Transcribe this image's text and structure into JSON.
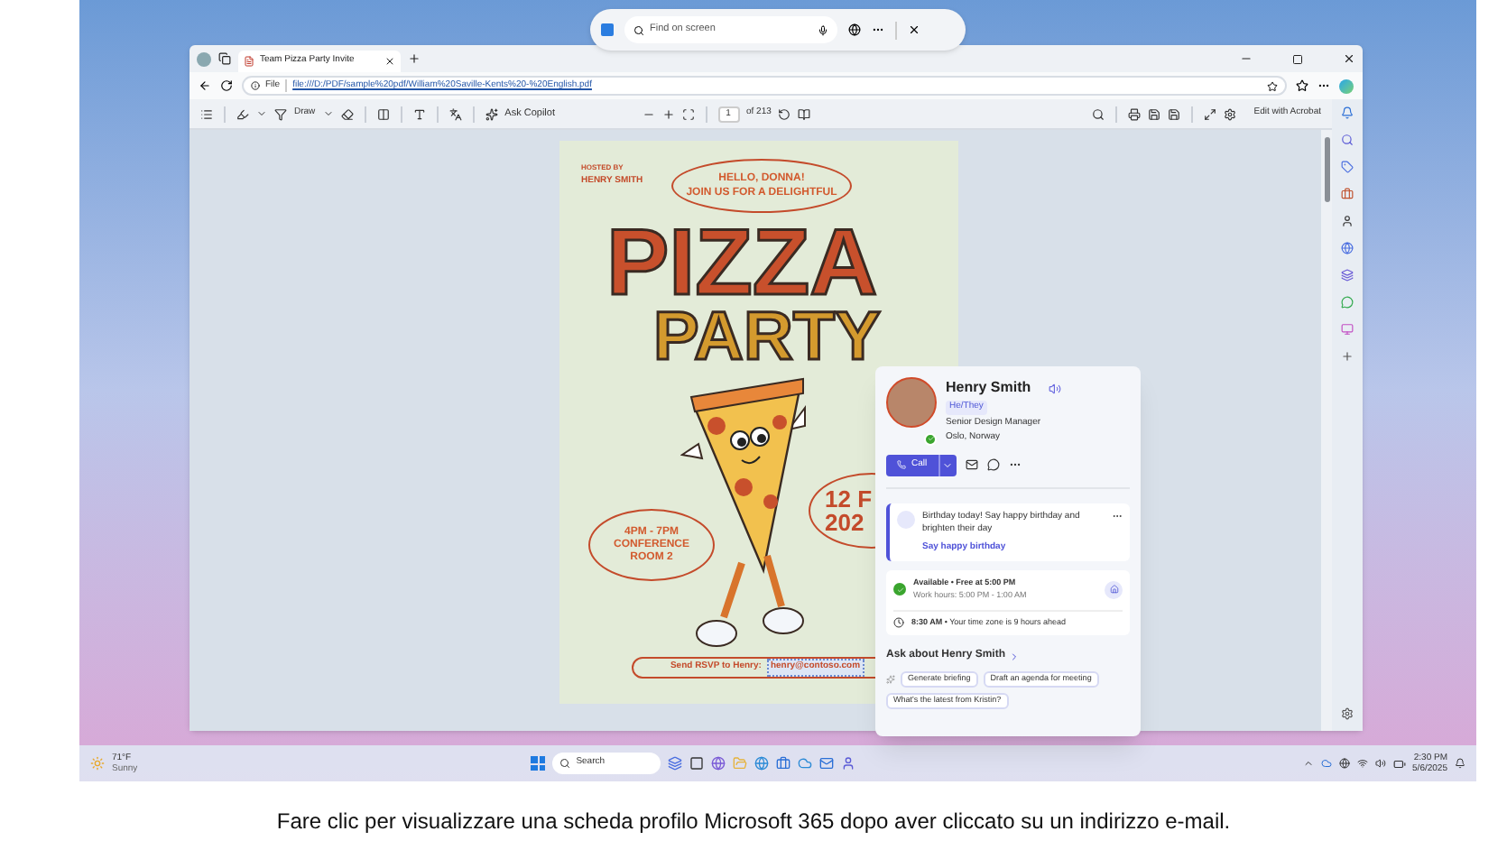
{
  "find_bar": {
    "placeholder": "Find on screen"
  },
  "browser": {
    "tab_title": "Team Pizza Party Invite",
    "address_label": "File",
    "url": "file:///D:/PDF/sample%20pdf/William%20Saville-Kents%20-%20English.pdf"
  },
  "pdf_toolbar": {
    "draw_label": "Draw",
    "ask_copilot": "Ask Copilot",
    "page": "1",
    "page_count": "of 213",
    "edit_label": "Edit with Acrobat"
  },
  "poster": {
    "hosted_by": "HOSTED BY",
    "host": "HENRY SMITH",
    "greeting": "HELLO, DONNA!",
    "invite": "JOIN US FOR A DELIGHTFUL",
    "title_1": "PIZZA",
    "title_2": "PARTY",
    "date_1": "12 F",
    "date_2": "202",
    "time": "4PM - 7PM",
    "place_1": "CONFERENCE",
    "place_2": "ROOM 2",
    "rsvp": "Send RSVP to Henry:",
    "email": "henry@contoso.com"
  },
  "profile_card": {
    "name": "Henry Smith",
    "pronouns": "He/They",
    "title": "Senior Design Manager",
    "location": "Oslo, Norway",
    "call_label": "Call",
    "birthday_text": "Birthday today! Say happy birthday and brighten their day",
    "birthday_link": "Say happy birthday",
    "availability": "Available • Free at 5:00 PM",
    "work_hours": "Work hours: 5:00 PM - 1:00 AM",
    "local_time": "**8:30 AM** • Your time zone is 9 hours ahead",
    "ask_heading": "Ask about Henry Smith",
    "suggestions": [
      "Generate briefing",
      "Draft an agenda for meeting",
      "What's the latest from Kristin?"
    ]
  },
  "taskbar": {
    "temperature": "71°F",
    "weather": "Sunny",
    "search": "Search",
    "time": "2:30 PM",
    "date": "5/6/2025"
  },
  "caption": "Fare clic per visualizzare una scheda profilo Microsoft 365 dopo aver cliccato su un indirizzo e-mail."
}
